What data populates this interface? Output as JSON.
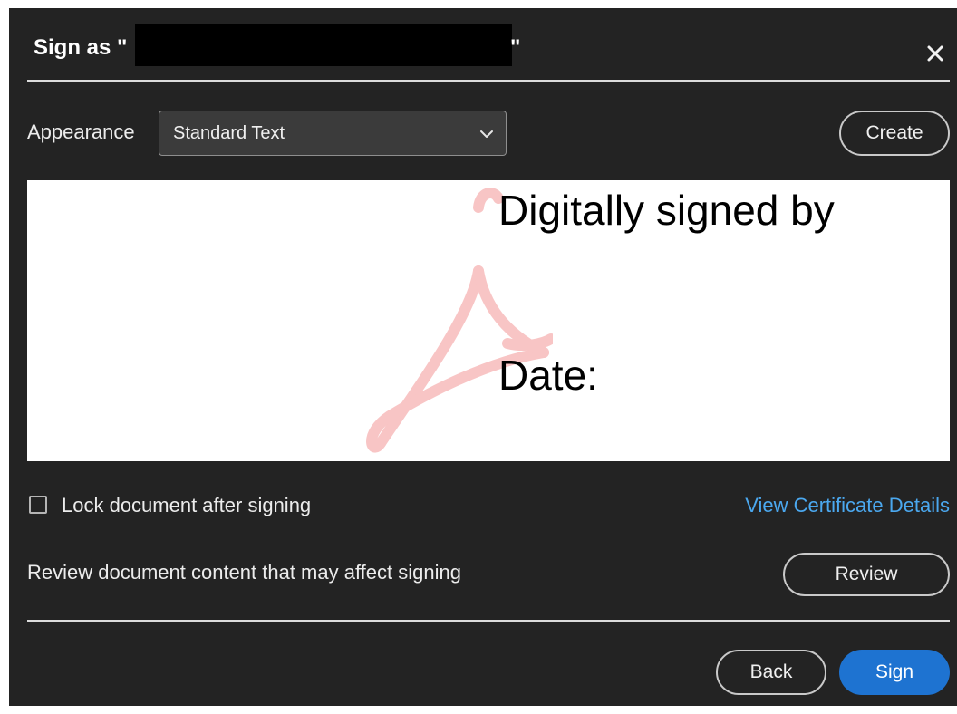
{
  "dialog": {
    "title_prefix": "Sign as \"",
    "title_suffix": "\"",
    "close_icon": "close-icon"
  },
  "appearance": {
    "label": "Appearance",
    "selected": "Standard Text",
    "create_label": "Create"
  },
  "preview": {
    "line1": "Digitally signed by",
    "line2": "Date:",
    "watermark_color": "#f4a3a3"
  },
  "options": {
    "lock_label": "Lock document after signing",
    "lock_checked": false,
    "cert_link": "View Certificate Details"
  },
  "review": {
    "text": "Review document content that may affect signing",
    "button": "Review"
  },
  "footer": {
    "back": "Back",
    "sign": "Sign"
  },
  "colors": {
    "background": "#232323",
    "accent": "#1e73d1",
    "link": "#4ba8ef"
  }
}
